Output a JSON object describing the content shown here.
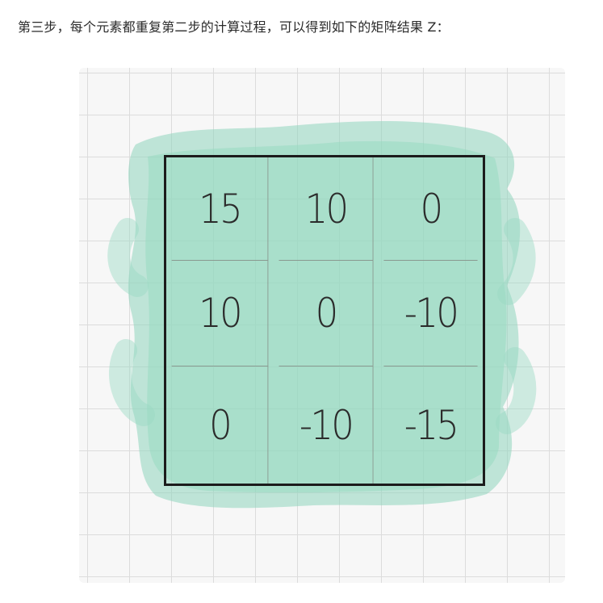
{
  "caption": "第三步，每个元素都重复第二步的计算过程，可以得到如下的矩阵结果 Z：",
  "matrix": {
    "rows": [
      [
        "15",
        "10",
        "0"
      ],
      [
        "10",
        "0",
        "-10"
      ],
      [
        "0",
        "-10",
        "-15"
      ]
    ]
  },
  "colors": {
    "wash": "#8fd6bd",
    "grid_line": "#dcdcdc",
    "border": "#1c1c1c",
    "text": "#2b2b2b"
  }
}
